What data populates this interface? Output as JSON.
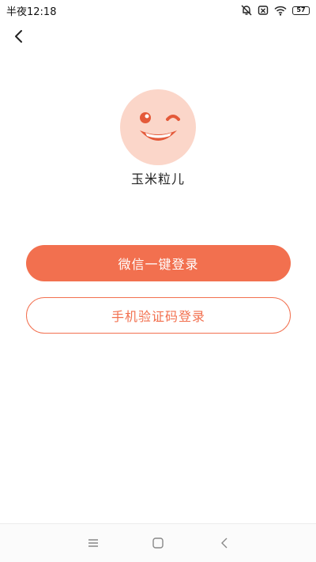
{
  "status_bar": {
    "time": "半夜12:18",
    "battery": "57",
    "icons": [
      "mute-bell-icon",
      "sim-off-icon",
      "wifi-icon",
      "battery-icon"
    ]
  },
  "header": {
    "back_icon": "chevron-left-icon"
  },
  "profile": {
    "avatar_icon": "smiley-face-icon",
    "username": "玉米粒儿"
  },
  "actions": {
    "wechat_login_label": "微信一键登录",
    "phone_login_label": "手机验证码登录"
  },
  "nav_bar": {
    "icons": [
      "menu-icon",
      "home-icon",
      "back-icon"
    ]
  },
  "colors": {
    "accent": "#f2704f",
    "avatar_bg": "#fbd6c9"
  }
}
